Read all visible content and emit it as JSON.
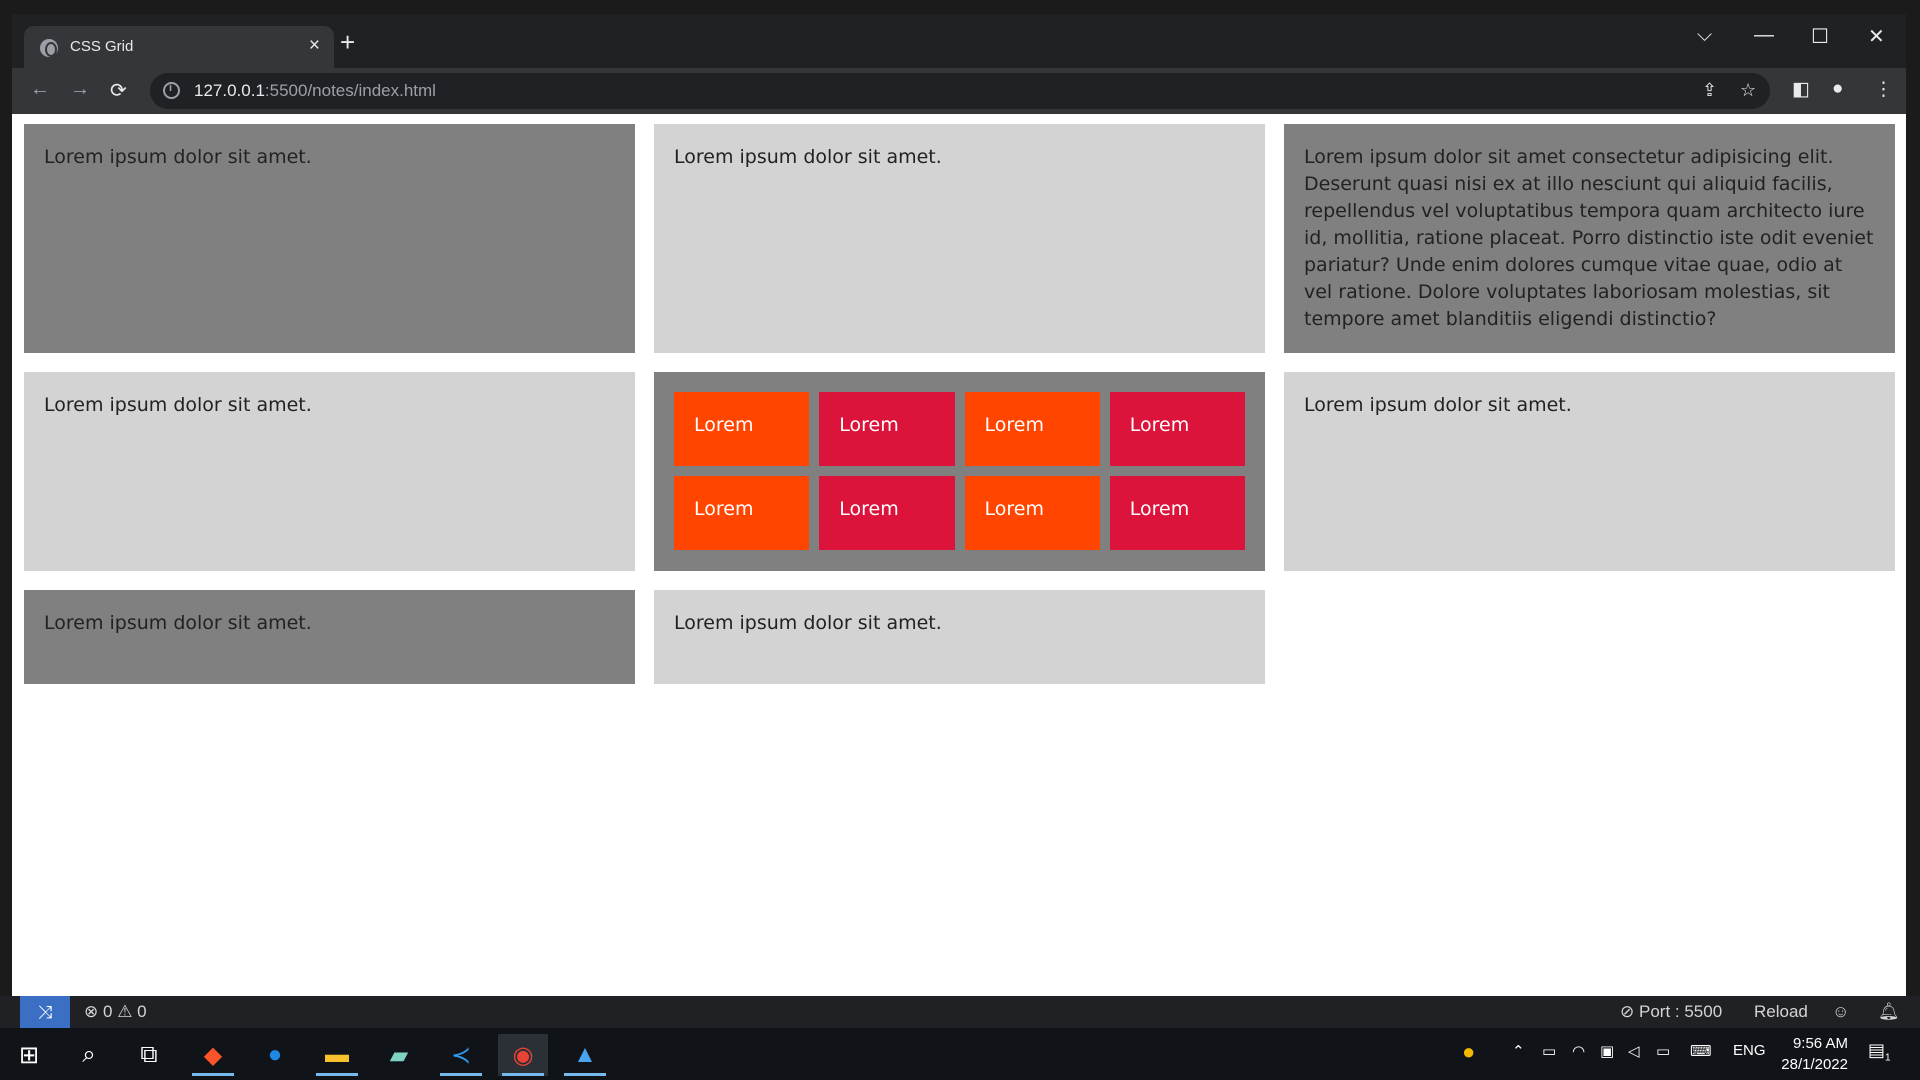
{
  "browser": {
    "tab_title": "CSS Grid",
    "url_host": "127.0.0.1",
    "url_path": ":5500/notes/index.html"
  },
  "page": {
    "row1": {
      "cell1": "Lorem ipsum dolor sit amet.",
      "cell2": "Lorem ipsum dolor sit amet.",
      "cell3": "Lorem ipsum dolor sit amet consectetur adipisicing elit. Deserunt quasi nisi ex at illo nesciunt qui aliquid facilis, repellendus vel voluptatibus tempora quam architecto iure id, mollitia, ratione placeat. Porro distinctio iste odit eveniet pariatur? Unde enim dolores cumque vitae quae, odio at vel ratione. Dolore voluptates laboriosam molestias, sit tempore amet blanditiis eligendi distinctio?"
    },
    "row2": {
      "cell1": "Lorem ipsum dolor sit amet.",
      "inner": [
        "Lorem",
        "Lorem",
        "Lorem",
        "Lorem",
        "Lorem",
        "Lorem",
        "Lorem",
        "Lorem"
      ],
      "cell3": "Lorem ipsum dolor sit amet."
    },
    "row3": {
      "cell1": "Lorem ipsum dolor sit amet.",
      "cell2": "Lorem ipsum dolor sit amet."
    },
    "colors": {
      "dark_cell": "#808080",
      "light_cell": "#d3d3d3",
      "inner_orange": "#ff4500",
      "inner_red": "#dc143c"
    }
  },
  "statusbar": {
    "errors": "0",
    "warnings": "0",
    "port": "Port : 5500",
    "reload": "Reload"
  },
  "taskbar": {
    "language": "ENG",
    "time": "9:56 AM",
    "date": "28/1/2022",
    "notifications": "1"
  }
}
